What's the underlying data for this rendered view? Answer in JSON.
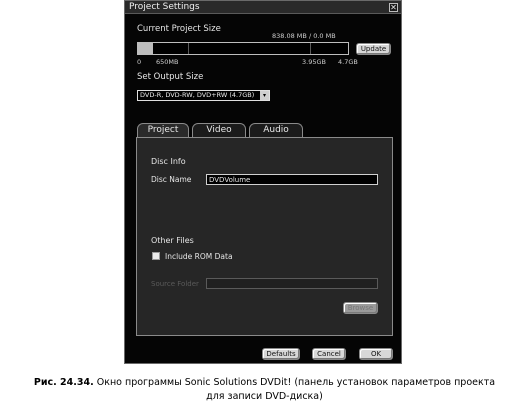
{
  "window": {
    "title": "Project Settings",
    "close_glyph": "✕"
  },
  "current_size": {
    "label": "Current Project Size",
    "readout": "838.08 MB / 0.0 MB",
    "fill_percent": 7,
    "scale": {
      "zero": "0",
      "mark_650": "650MB",
      "mark_3": "3.95GB",
      "mark_4": "4.7GB"
    },
    "update_label": "Update"
  },
  "output_size": {
    "label": "Set Output Size",
    "selected": "DVD-R, DVD-RW, DVD+RW (4.7GB)",
    "arrow_glyph": "▾"
  },
  "tabs": [
    {
      "label": "Project",
      "active": true
    },
    {
      "label": "Video",
      "active": false
    },
    {
      "label": "Audio",
      "active": false
    }
  ],
  "disc_info": {
    "heading": "Disc Info",
    "name_label": "Disc Name",
    "name_value": "DVDVolume"
  },
  "other_files": {
    "heading": "Other Files",
    "include_rom_label": "Include ROM Data",
    "include_rom_checked": false,
    "source_folder_label": "Source Folder",
    "source_folder_value": "",
    "browse_label": "Browse"
  },
  "footer": {
    "defaults_label": "Defaults",
    "cancel_label": "Cancel",
    "ok_label": "OK"
  },
  "caption": {
    "prefix": "Рис. 24.34.",
    "line1": " Окно программы Sonic Solutions DVDit! (панель установок параметров проекта",
    "line2": "для записи DVD-диска)"
  }
}
